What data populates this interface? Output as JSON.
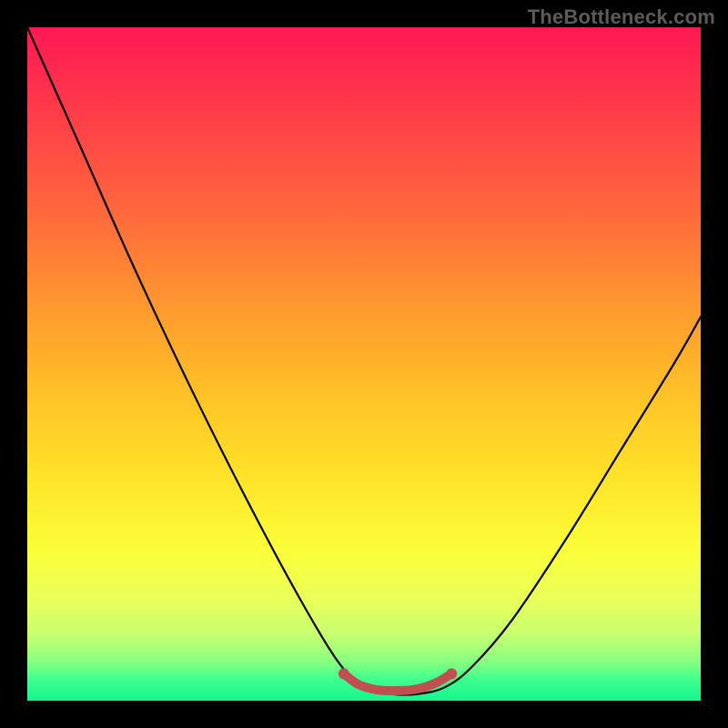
{
  "watermark": "TheBottleneck.com",
  "chart_data": {
    "type": "line",
    "title": "",
    "xlabel": "",
    "ylabel": "",
    "xlim": [
      0,
      100
    ],
    "ylim": [
      0,
      100
    ],
    "grid": false,
    "legend": false,
    "background_gradient": {
      "top": "#ff1854",
      "bottom": "#17f58c"
    },
    "series": [
      {
        "name": "black-curve",
        "color": "#000000",
        "x": [
          0,
          8,
          16,
          24,
          32,
          40,
          46,
          50,
          54,
          58,
          62,
          66,
          72,
          80,
          88,
          96,
          100
        ],
        "y": [
          100,
          82,
          64,
          47,
          31,
          16,
          6,
          2,
          1,
          1,
          2,
          5,
          12,
          24,
          37,
          50,
          57
        ]
      },
      {
        "name": "red-band",
        "color": "#c05050",
        "x": [
          47,
          49,
          51,
          53,
          55,
          57,
          59,
          61,
          63
        ],
        "y": [
          4,
          2.5,
          1.8,
          1.5,
          1.5,
          1.6,
          2.0,
          2.8,
          4
        ]
      }
    ]
  }
}
